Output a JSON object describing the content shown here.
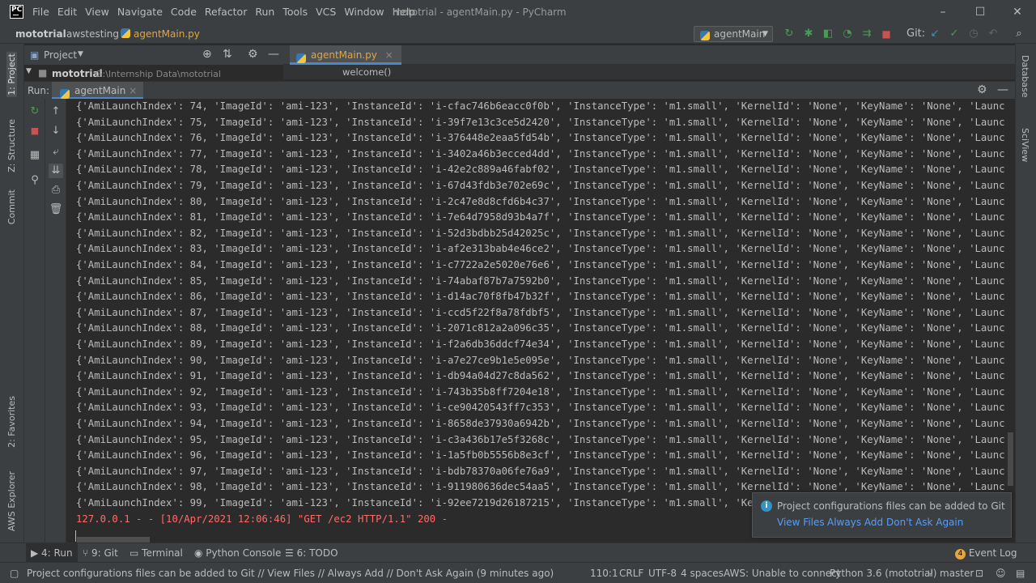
{
  "window": {
    "title": "mototrial - agentMain.py - PyCharm",
    "logo": "PC",
    "menu": [
      "File",
      "Edit",
      "View",
      "Navigate",
      "Code",
      "Refactor",
      "Run",
      "Tools",
      "VCS",
      "Window",
      "Help"
    ],
    "controls": {
      "minimize": "–",
      "maximize": "☐",
      "close": "✕"
    }
  },
  "navbar": {
    "project": "mototrial",
    "folder": "awstesting",
    "file": "agentMain.py",
    "run_config": "agentMain",
    "git_label": "Git:"
  },
  "project_panel": {
    "title": "Project",
    "root_name": "mototrial",
    "root_path": "G:\\Internship Data\\mototrial"
  },
  "editor": {
    "tab": "agentMain.py",
    "breadcrumb": "welcome()"
  },
  "left_strip": {
    "project": "1: Project",
    "structure": "Z: Structure",
    "commit": "Commit",
    "favorites": "2: Favorites",
    "aws": "AWS Explorer"
  },
  "right_strip": {
    "database": "Database",
    "sciview": "SciView"
  },
  "run_panel": {
    "label": "Run:",
    "tab": "agentMain"
  },
  "console": {
    "lines": [
      "{'AmiLaunchIndex': 74, 'ImageId': 'ami-123', 'InstanceId': 'i-cfac746b6eacc0f0b', 'InstanceType': 'm1.small', 'KernelId': 'None', 'KeyName': 'None', 'Launc",
      "{'AmiLaunchIndex': 75, 'ImageId': 'ami-123', 'InstanceId': 'i-39f7e13c3ce5d2420', 'InstanceType': 'm1.small', 'KernelId': 'None', 'KeyName': 'None', 'Launc",
      "{'AmiLaunchIndex': 76, 'ImageId': 'ami-123', 'InstanceId': 'i-376448e2eaa5fd54b', 'InstanceType': 'm1.small', 'KernelId': 'None', 'KeyName': 'None', 'Launc",
      "{'AmiLaunchIndex': 77, 'ImageId': 'ami-123', 'InstanceId': 'i-3402a46b3ecced4dd', 'InstanceType': 'm1.small', 'KernelId': 'None', 'KeyName': 'None', 'Launc",
      "{'AmiLaunchIndex': 78, 'ImageId': 'ami-123', 'InstanceId': 'i-42e2c889a46fabf02', 'InstanceType': 'm1.small', 'KernelId': 'None', 'KeyName': 'None', 'Launc",
      "{'AmiLaunchIndex': 79, 'ImageId': 'ami-123', 'InstanceId': 'i-67d43fdb3e702e69c', 'InstanceType': 'm1.small', 'KernelId': 'None', 'KeyName': 'None', 'Launc",
      "{'AmiLaunchIndex': 80, 'ImageId': 'ami-123', 'InstanceId': 'i-2c47e8d8cfd6b4c37', 'InstanceType': 'm1.small', 'KernelId': 'None', 'KeyName': 'None', 'Launc",
      "{'AmiLaunchIndex': 81, 'ImageId': 'ami-123', 'InstanceId': 'i-7e64d7958d93b4a7f', 'InstanceType': 'm1.small', 'KernelId': 'None', 'KeyName': 'None', 'Launc",
      "{'AmiLaunchIndex': 82, 'ImageId': 'ami-123', 'InstanceId': 'i-52d3bdbb25d42025c', 'InstanceType': 'm1.small', 'KernelId': 'None', 'KeyName': 'None', 'Launc",
      "{'AmiLaunchIndex': 83, 'ImageId': 'ami-123', 'InstanceId': 'i-af2e313bab4e46ce2', 'InstanceType': 'm1.small', 'KernelId': 'None', 'KeyName': 'None', 'Launc",
      "{'AmiLaunchIndex': 84, 'ImageId': 'ami-123', 'InstanceId': 'i-c7722a2e5020e76e6', 'InstanceType': 'm1.small', 'KernelId': 'None', 'KeyName': 'None', 'Launc",
      "{'AmiLaunchIndex': 85, 'ImageId': 'ami-123', 'InstanceId': 'i-74abaf87b7a7592b0', 'InstanceType': 'm1.small', 'KernelId': 'None', 'KeyName': 'None', 'Launc",
      "{'AmiLaunchIndex': 86, 'ImageId': 'ami-123', 'InstanceId': 'i-d14ac70f8fb47b32f', 'InstanceType': 'm1.small', 'KernelId': 'None', 'KeyName': 'None', 'Launc",
      "{'AmiLaunchIndex': 87, 'ImageId': 'ami-123', 'InstanceId': 'i-ccd5f22f8a78fdbf5', 'InstanceType': 'm1.small', 'KernelId': 'None', 'KeyName': 'None', 'Launc",
      "{'AmiLaunchIndex': 88, 'ImageId': 'ami-123', 'InstanceId': 'i-2071c812a2a096c35', 'InstanceType': 'm1.small', 'KernelId': 'None', 'KeyName': 'None', 'Launc",
      "{'AmiLaunchIndex': 89, 'ImageId': 'ami-123', 'InstanceId': 'i-f2a6db36ddcf74e34', 'InstanceType': 'm1.small', 'KernelId': 'None', 'KeyName': 'None', 'Launc",
      "{'AmiLaunchIndex': 90, 'ImageId': 'ami-123', 'InstanceId': 'i-a7e27ce9b1e5e095e', 'InstanceType': 'm1.small', 'KernelId': 'None', 'KeyName': 'None', 'Launc",
      "{'AmiLaunchIndex': 91, 'ImageId': 'ami-123', 'InstanceId': 'i-db94a04d27c8da562', 'InstanceType': 'm1.small', 'KernelId': 'None', 'KeyName': 'None', 'Launc",
      "{'AmiLaunchIndex': 92, 'ImageId': 'ami-123', 'InstanceId': 'i-743b35b8ff7204e18', 'InstanceType': 'm1.small', 'KernelId': 'None', 'KeyName': 'None', 'Launc",
      "{'AmiLaunchIndex': 93, 'ImageId': 'ami-123', 'InstanceId': 'i-ce90420543ff7c353', 'InstanceType': 'm1.small', 'KernelId': 'None', 'KeyName': 'None', 'Launc",
      "{'AmiLaunchIndex': 94, 'ImageId': 'ami-123', 'InstanceId': 'i-8658de37930a6942b', 'InstanceType': 'm1.small', 'KernelId': 'None', 'KeyName': 'None', 'Launc",
      "{'AmiLaunchIndex': 95, 'ImageId': 'ami-123', 'InstanceId': 'i-c3a436b17e5f3268c', 'InstanceType': 'm1.small', 'KernelId': 'None', 'KeyName': 'None', 'Launc",
      "{'AmiLaunchIndex': 96, 'ImageId': 'ami-123', 'InstanceId': 'i-1a5fb0b5556b8e3cf', 'InstanceType': 'm1.small', 'KernelId': 'None', 'KeyName': 'None', 'Launc",
      "{'AmiLaunchIndex': 97, 'ImageId': 'ami-123', 'InstanceId': 'i-bdb78370a06fe76a9', 'InstanceType': 'm1.small', 'KernelId': 'None', 'KeyName': 'None', 'Launc",
      "{'AmiLaunchIndex': 98, 'ImageId': 'ami-123', 'InstanceId': 'i-911980636dec54aa5', 'InstanceType': 'm1.small', 'KernelId': 'None', 'KeyName': 'None', 'Launc",
      "{'AmiLaunchIndex': 99, 'ImageId': 'ami-123', 'InstanceId': 'i-92ee7219d26187215', 'InstanceType': 'm1.small', 'KernelId': 'None', 'KeyName': 'None', 'Launc"
    ],
    "server_log": "127.0.0.1 - - [10/Apr/2021 12:06:46] \"GET /ec2 HTTP/1.1\" 200 -"
  },
  "notification": {
    "message": "Project configurations files can be added to Git",
    "links": [
      "View Files",
      "Always Add",
      "Don't Ask Again"
    ]
  },
  "bottom_tabs": {
    "run": "4: Run",
    "git": "9: Git",
    "terminal": "Terminal",
    "python_console": "Python Console",
    "todo": "6: TODO",
    "event_log": "Event Log",
    "event_count": "4"
  },
  "status_bar": {
    "message": "Project configurations files can be added to Git // View Files // Always Add // Don't Ask Again (9 minutes ago)",
    "position": "110:1",
    "line_sep": "CRLF",
    "encoding": "UTF-8",
    "indent": "4 spaces",
    "aws": "AWS: Unable to connect",
    "interpreter": "Python 3.6 (mototrial)",
    "branch": "master"
  },
  "colors": {
    "accent": "#4a88c7",
    "error": "#ff6b68",
    "link": "#589df6",
    "bg": "#2b2b2b",
    "panel": "#3c3f41"
  }
}
